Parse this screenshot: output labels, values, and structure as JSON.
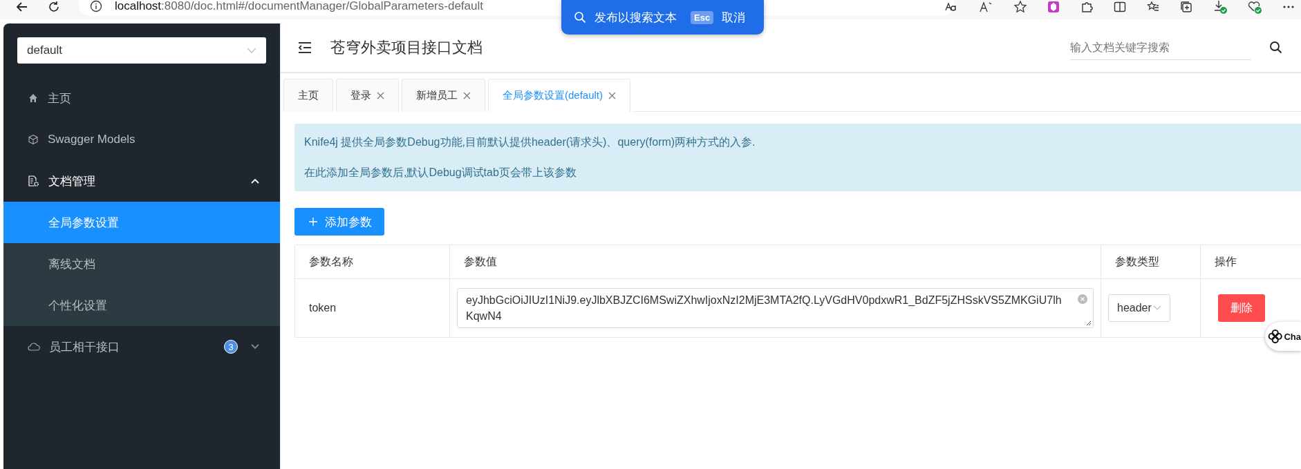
{
  "browser": {
    "url_host": "localhost",
    "url_rest": ":8080/doc.html#/documentManager/GlobalParameters-default"
  },
  "find_popup": {
    "label": "发布以搜索文本",
    "key": "Esc",
    "cancel": "取消"
  },
  "sidebar": {
    "group_select": "default",
    "items": [
      {
        "kind": "home",
        "label": "主页",
        "selected": false
      },
      {
        "kind": "models",
        "label": "Swagger Models",
        "selected": false
      },
      {
        "kind": "docs",
        "label": "文档管理",
        "selected": false,
        "expanded": true,
        "children": [
          {
            "label": "全局参数设置",
            "selected": true
          },
          {
            "label": "离线文档",
            "selected": false
          },
          {
            "label": "个性化设置",
            "selected": false
          }
        ]
      },
      {
        "kind": "api",
        "label": "员工相干接口",
        "selected": false,
        "expanded": false,
        "badge": "3"
      }
    ]
  },
  "header": {
    "title": "苍穹外卖项目接口文档",
    "search_placeholder": "输入文档关键字搜索"
  },
  "tabs": [
    {
      "label": "主页",
      "closable": false,
      "selected": false
    },
    {
      "label": "登录",
      "closable": true,
      "selected": false
    },
    {
      "label": "新增员工",
      "closable": true,
      "selected": false
    },
    {
      "label": "全局参数设置(default)",
      "closable": true,
      "selected": true
    }
  ],
  "alert": {
    "lines": [
      "Knife4j 提供全局参数Debug功能,目前默认提供header(请求头)、query(form)两种方式的入参.",
      "在此添加全局参数后,默认Debug调试tab页会带上该参数"
    ]
  },
  "add_button": "添加参数",
  "table": {
    "columns": [
      "参数名称",
      "参数值",
      "参数类型",
      "操作"
    ],
    "rows": [
      {
        "name": "token",
        "value": "eyJhbGciOiJIUzI1NiJ9.eyJlbXBJZCI6MSwiZXhwIjoxNzI2MjE3MTA2fQ.LyVGdHV0pdxwR1_BdZF5jZHSskVS5ZMKGiU7lhKqwN4",
        "type": "header",
        "action": "删除"
      }
    ]
  },
  "side_badge": "Cha"
}
